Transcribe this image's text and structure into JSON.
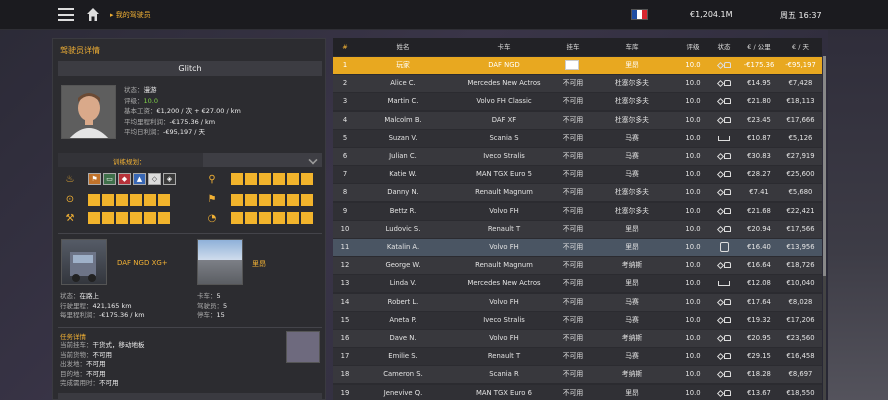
{
  "topbar": {
    "breadcrumb": "我的驾驶员",
    "money": "€1,204.1M",
    "clock": "周五 16:37",
    "flag_colors": [
      "#1f4ea3",
      "#ffffff",
      "#d8262f"
    ]
  },
  "driver": {
    "panel_title": "驾驶员详情",
    "name": "Glitch",
    "status_label": "状态：",
    "status_value": "漫游",
    "rating_label": "评级：",
    "rating_value": "10.0",
    "wage_label": "基本工资：",
    "wage_value": "€1,200 / 次 + €27.00 / km",
    "avg_profit_label": "平均里程利润：",
    "avg_profit_value": "-€175.36 / km",
    "daily_profit_label": "平均日利润：",
    "daily_profit_value": "-€95,197 / 天"
  },
  "training": {
    "title": "训练规划：",
    "adr_icons": [
      "⚑",
      "▭",
      "◆",
      "▲",
      "◇",
      "◈"
    ]
  },
  "truck": {
    "name": "DAF NGD XG+",
    "garage": "里昂",
    "status_label": "状态：",
    "status_value": "在路上",
    "odometer_label": "行驶里程：",
    "odometer_value": "421,165 km",
    "per_km_label": "每里程利润：",
    "per_km_value": "-€175.36 / km",
    "trucks_label": "卡车：",
    "trucks_value": "5",
    "drivers_label": "驾驶员：",
    "drivers_value": "5",
    "slots_label": "停车：",
    "slots_value": "15"
  },
  "task": {
    "title": "任务详情",
    "trailer_label": "当前挂车：",
    "trailer_value": "干货式，移动地板",
    "cargo_label": "当前货物：",
    "cargo_value": "不可用",
    "origin_label": "出发地：",
    "origin_value": "不可用",
    "dest_label": "目的地：",
    "dest_value": "不可用",
    "deadline_label": "完成需用时：",
    "deadline_value": "不可用"
  },
  "table": {
    "headers": [
      "#",
      "姓名",
      "卡车",
      "挂车",
      "车库",
      "评级",
      "状态",
      "€ / 公里",
      "€ / 天"
    ],
    "rows": [
      {
        "n": "1",
        "name": "玩家",
        "truck": "DAF NGD",
        "trailer": "",
        "garage": "里昂",
        "rating": "10.0",
        "status": "drive",
        "per_km": "-€175.36",
        "per_day": "-€95,197"
      },
      {
        "n": "2",
        "name": "Alice C.",
        "truck": "Mercedes New Actros",
        "trailer": "不可用",
        "garage": "杜塞尔多夫",
        "rating": "10.0",
        "status": "drive",
        "per_km": "€14.95",
        "per_day": "€7,428"
      },
      {
        "n": "3",
        "name": "Martin C.",
        "truck": "Volvo FH Classic",
        "trailer": "不可用",
        "garage": "杜塞尔多夫",
        "rating": "10.0",
        "status": "drive",
        "per_km": "€21.80",
        "per_day": "€18,113"
      },
      {
        "n": "4",
        "name": "Malcolm B.",
        "truck": "DAF XF",
        "trailer": "不可用",
        "garage": "杜塞尔多夫",
        "rating": "10.0",
        "status": "drive",
        "per_km": "€23.45",
        "per_day": "€17,666"
      },
      {
        "n": "5",
        "name": "Suzan V.",
        "truck": "Scania S",
        "trailer": "不可用",
        "garage": "马赛",
        "rating": "10.0",
        "status": "sleep",
        "per_km": "€10.87",
        "per_day": "€5,126"
      },
      {
        "n": "6",
        "name": "Julian C.",
        "truck": "Iveco Stralis",
        "trailer": "不可用",
        "garage": "马赛",
        "rating": "10.0",
        "status": "drive",
        "per_km": "€30.83",
        "per_day": "€27,919"
      },
      {
        "n": "7",
        "name": "Katie W.",
        "truck": "MAN TGX Euro 5",
        "trailer": "不可用",
        "garage": "马赛",
        "rating": "10.0",
        "status": "drive",
        "per_km": "€28.27",
        "per_day": "€25,600"
      },
      {
        "n": "8",
        "name": "Danny N.",
        "truck": "Renault Magnum",
        "trailer": "不可用",
        "garage": "杜塞尔多夫",
        "rating": "10.0",
        "status": "drive",
        "per_km": "€7.41",
        "per_day": "€5,680"
      },
      {
        "n": "9",
        "name": "Bettz R.",
        "truck": "Volvo FH",
        "trailer": "不可用",
        "garage": "杜塞尔多夫",
        "rating": "10.0",
        "status": "drive",
        "per_km": "€21.68",
        "per_day": "€22,421"
      },
      {
        "n": "10",
        "name": "Ludovic S.",
        "truck": "Renault T",
        "trailer": "不可用",
        "garage": "里昂",
        "rating": "10.0",
        "status": "drive",
        "per_km": "€20.94",
        "per_day": "€17,566"
      },
      {
        "n": "11",
        "name": "Katalin A.",
        "truck": "Volvo FH",
        "trailer": "不可用",
        "garage": "里昂",
        "rating": "10.0",
        "status": "person",
        "per_km": "€16.40",
        "per_day": "€13,956"
      },
      {
        "n": "12",
        "name": "George W.",
        "truck": "Renault Magnum",
        "trailer": "不可用",
        "garage": "考纳斯",
        "rating": "10.0",
        "status": "drive",
        "per_km": "€16.64",
        "per_day": "€18,726"
      },
      {
        "n": "13",
        "name": "Linda V.",
        "truck": "Mercedes New Actros",
        "trailer": "不可用",
        "garage": "里昂",
        "rating": "10.0",
        "status": "sleep",
        "per_km": "€12.08",
        "per_day": "€10,040"
      },
      {
        "n": "14",
        "name": "Robert L.",
        "truck": "Volvo FH",
        "trailer": "不可用",
        "garage": "马赛",
        "rating": "10.0",
        "status": "drive",
        "per_km": "€17.64",
        "per_day": "€8,028"
      },
      {
        "n": "15",
        "name": "Aneta P.",
        "truck": "Iveco Stralis",
        "trailer": "不可用",
        "garage": "马赛",
        "rating": "10.0",
        "status": "drive",
        "per_km": "€19.32",
        "per_day": "€17,206"
      },
      {
        "n": "16",
        "name": "Dave N.",
        "truck": "Volvo FH",
        "trailer": "不可用",
        "garage": "考纳斯",
        "rating": "10.0",
        "status": "drive",
        "per_km": "€20.95",
        "per_day": "€23,560"
      },
      {
        "n": "17",
        "name": "Emilie S.",
        "truck": "Renault T",
        "trailer": "不可用",
        "garage": "马赛",
        "rating": "10.0",
        "status": "drive",
        "per_km": "€29.15",
        "per_day": "€16,458"
      },
      {
        "n": "18",
        "name": "Cameron S.",
        "truck": "Scania R",
        "trailer": "不可用",
        "garage": "考纳斯",
        "rating": "10.0",
        "status": "drive",
        "per_km": "€18.28",
        "per_day": "€8,697"
      },
      {
        "n": "19",
        "name": "Jenevive Q.",
        "truck": "MAN TGX Euro 6",
        "trailer": "不可用",
        "garage": "里昂",
        "rating": "10.0",
        "status": "drive",
        "per_km": "€13.67",
        "per_day": "€18,550"
      }
    ]
  }
}
